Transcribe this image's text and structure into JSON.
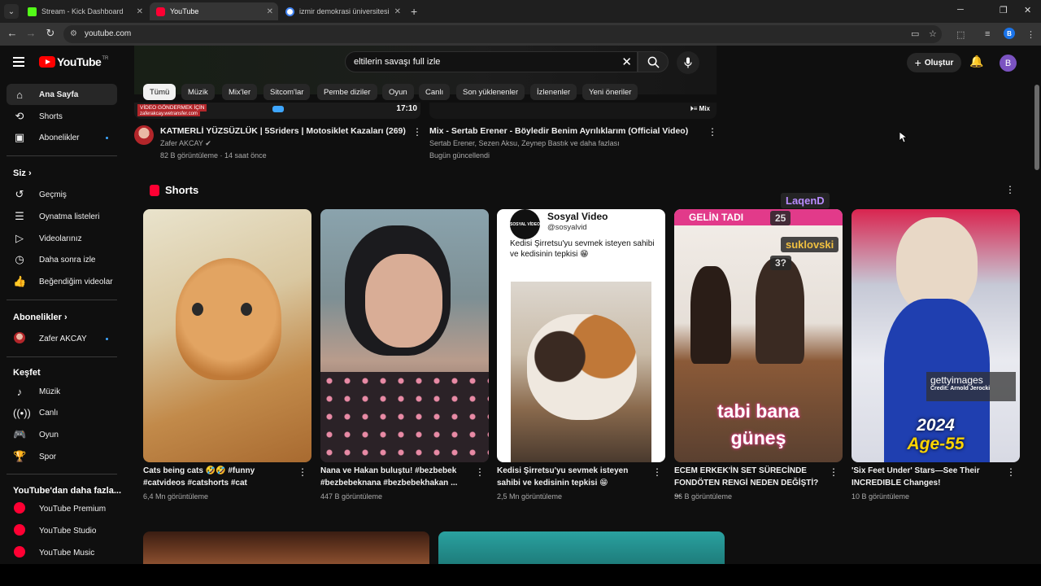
{
  "browser": {
    "tabs": [
      {
        "title": "Stream - Kick Dashboard",
        "favicon_color": "#53fc18",
        "active": false
      },
      {
        "title": "YouTube",
        "favicon_color": "#ff0033",
        "active": true
      },
      {
        "title": "izmir demokrasi üniversitesi tıp",
        "favicon_color": "#4285f4",
        "active": false
      }
    ],
    "url": "youtube.com",
    "profile_letter": "B"
  },
  "masthead": {
    "logo_text": "YouTube",
    "logo_region": "TR",
    "search_value": "eltilerin savaşı full izle",
    "create_label": "Oluştur",
    "avatar_letter": "B"
  },
  "sidebar": {
    "main": [
      {
        "label": "Ana Sayfa",
        "icon": "home-icon",
        "active": true
      },
      {
        "label": "Shorts",
        "icon": "shorts-icon",
        "active": false
      },
      {
        "label": "Abonelikler",
        "icon": "subscriptions-icon",
        "active": false,
        "dot": true
      }
    ],
    "you_head": "Siz",
    "you": [
      {
        "label": "Geçmiş",
        "icon": "history-icon"
      },
      {
        "label": "Oynatma listeleri",
        "icon": "playlists-icon"
      },
      {
        "label": "Videolarınız",
        "icon": "your-videos-icon"
      },
      {
        "label": "Daha sonra izle",
        "icon": "watch-later-icon"
      },
      {
        "label": "Beğendiğim videolar",
        "icon": "like-icon"
      }
    ],
    "subs_head": "Abonelikler",
    "subs": [
      {
        "label": "Zafer AKCAY",
        "dot": true
      }
    ],
    "explore_head": "Keşfet",
    "explore": [
      {
        "label": "Müzik",
        "icon": "music-icon"
      },
      {
        "label": "Canlı",
        "icon": "live-icon"
      },
      {
        "label": "Oyun",
        "icon": "gaming-icon"
      },
      {
        "label": "Spor",
        "icon": "trophy-icon"
      }
    ],
    "more_head": "YouTube'dan daha fazla...",
    "more": [
      {
        "label": "YouTube Premium"
      },
      {
        "label": "YouTube Studio"
      },
      {
        "label": "YouTube Music"
      }
    ]
  },
  "chips": [
    "Tümü",
    "Müzik",
    "Mix'ler",
    "Sitcom'lar",
    "Pembe diziler",
    "Oyun",
    "Canlı",
    "Son yüklenenler",
    "İzlenenler",
    "Yeni öneriler"
  ],
  "videos": [
    {
      "title": "KATMERLİ YÜZSÜZLÜK | 5Sriders | Motosiklet Kazaları (269)",
      "channel": "Zafer AKCAY",
      "meta": "82 B görüntüleme · 14 saat önce",
      "thumb_text": "VİDEO GÖNDERMEK İÇİN",
      "thumb_subtext": "zaferakcay.wetransfer.com",
      "duration": "17:10"
    },
    {
      "title": "Mix - Sertab Erener - Böyledir Benim Ayrılıklarım (Official Video)",
      "channel": "Sertab Erener, Sezen Aksu, Zeynep Bastık ve daha fazlası",
      "meta": "Bugün güncellendi",
      "badge": "Mix"
    }
  ],
  "shorts": {
    "heading": "Shorts",
    "items": [
      {
        "title": "Cats being cats 🤣🤣 #funny #catvideos #catshorts #cat",
        "views": "6,4 Mn görüntüleme"
      },
      {
        "title": "Nana ve Hakan buluştu! #bezbebek #bezbebeknana #bezbebekhakan ...",
        "views": "447 B görüntüleme"
      },
      {
        "title": "Kedisi Şirretsu'yu sevmek isteyen sahibi ve kedisinin tepkisi 😁",
        "views": "2,5 Mn görüntüleme",
        "overlay_title": "Sosyal Video",
        "overlay_handle": "@sosyalvid",
        "overlay_caption": "Kedisi Şirretsu'yu sevmek isteyen sahibi ve kedisinin tepkisi 😁",
        "overlay_logo": "SOSYAL VİDEO"
      },
      {
        "title": "ECEM ERKEK'İN SET SÜRECİNDE FONDÖTEN RENGİ NEDEN DEĞİŞTİ? ...",
        "views": "36 B görüntüleme",
        "overlay_top": "GELİN TADI",
        "overlay_bottom_1": "tabi bana",
        "overlay_bottom_2": "güneş"
      },
      {
        "title": "'Six Feet Under' Stars—See Their INCREDIBLE Changes!",
        "views": "10 B görüntüleme",
        "overlay_brand": "gettyimages",
        "overlay_credit": "Credit: Arnold Jerocki",
        "overlay_year": "2024",
        "overlay_age": "Age-55"
      }
    ]
  },
  "stream_overlay": {
    "names": [
      "LaqenD",
      "suklovski"
    ],
    "numbers": [
      "25",
      "3?"
    ]
  },
  "colors": {
    "accent_red": "#ff0033",
    "background": "#0f0f0f",
    "link_blue": "#3ea6ff"
  }
}
